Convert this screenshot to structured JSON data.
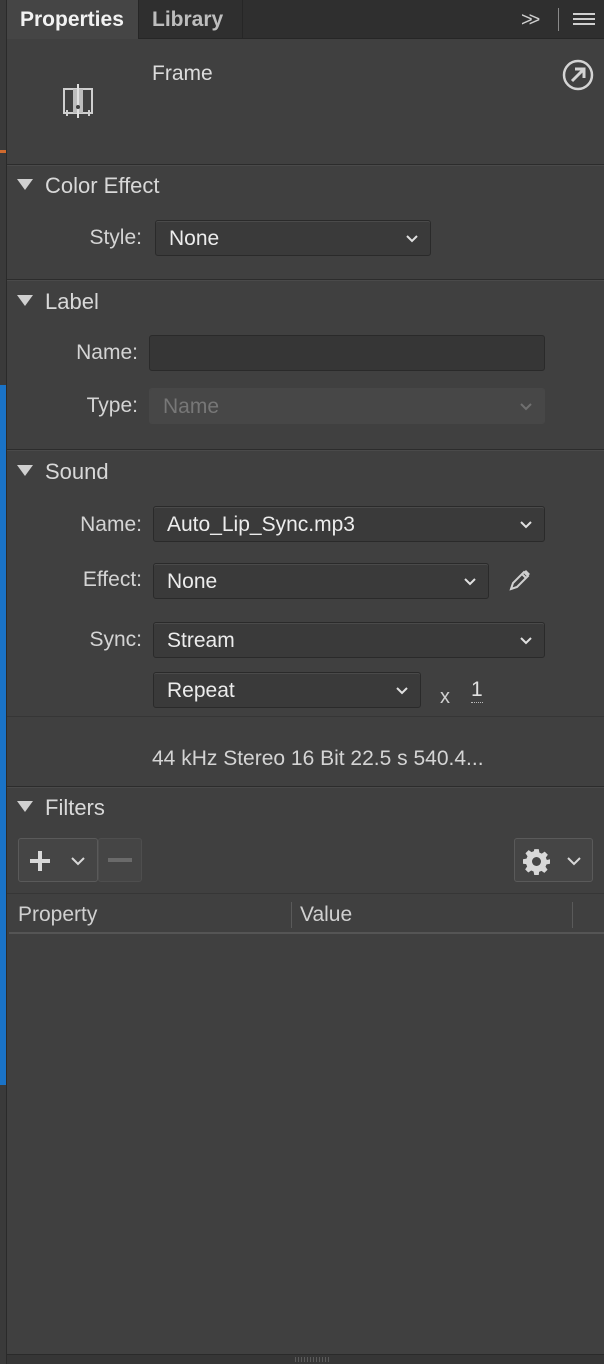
{
  "tabs": [
    {
      "label": "Properties",
      "active": true
    },
    {
      "label": "Library",
      "active": false
    }
  ],
  "tabbar": {
    "expand_glyph": ">>",
    "menu_icon": "hamburger-menu-icon"
  },
  "header": {
    "title": "Frame",
    "icon": "frame-icon",
    "action_icon": "goto-arrow-icon"
  },
  "color_effect": {
    "title": "Color Effect",
    "style_label": "Style:",
    "style_value": "None"
  },
  "label_section": {
    "title": "Label",
    "name_label": "Name:",
    "name_value": "",
    "type_label": "Type:",
    "type_value": "Name"
  },
  "sound": {
    "title": "Sound",
    "name_label": "Name:",
    "name_value": "Auto_Lip_Sync.mp3",
    "effect_label": "Effect:",
    "effect_value": "None",
    "edit_icon": "pencil-icon",
    "sync_label": "Sync:",
    "sync_value": "Stream",
    "repeat_value": "Repeat",
    "repeat_x": "x",
    "repeat_count": "1",
    "info": "44 kHz Stereo 16 Bit 22.5 s 540.4..."
  },
  "filters": {
    "title": "Filters",
    "add_icon": "plus-icon",
    "remove_icon": "minus-icon",
    "options_icon": "gear-icon",
    "columns": [
      "Property",
      "Value"
    ]
  },
  "colors": {
    "panel_bg": "#404040",
    "tab_bar": "#2f2f2f",
    "edge_accent_orange": "#d06a2e",
    "edge_accent_blue": "#1a73c7"
  }
}
